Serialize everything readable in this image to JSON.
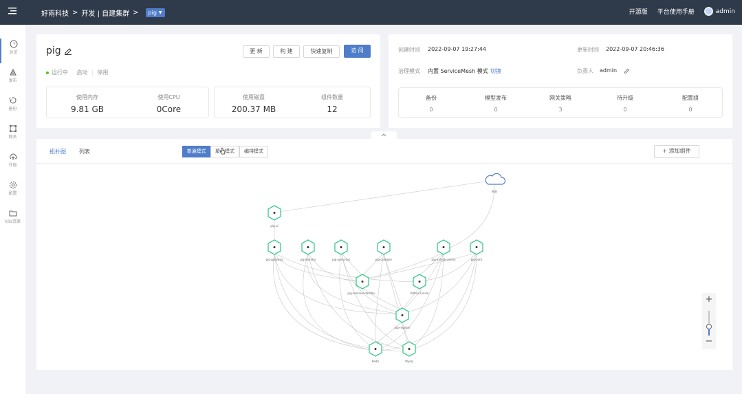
{
  "topbar": {
    "org": "好雨科技",
    "sep1": ">",
    "team": "开发 | 自建集群",
    "sep2": ">",
    "app": "pig",
    "open_source": "开源版",
    "manual": "平台使用手册",
    "user": "admin"
  },
  "sidebar": {
    "items": [
      {
        "label": "总览",
        "icon": "dashboard-icon"
      },
      {
        "label": "发布",
        "icon": "publish-icon"
      },
      {
        "label": "备份",
        "icon": "backup-icon"
      },
      {
        "label": "网关",
        "icon": "gateway-icon"
      },
      {
        "label": "升级",
        "icon": "upgrade-icon"
      },
      {
        "label": "配置",
        "icon": "config-icon"
      },
      {
        "label": "k8s资源",
        "icon": "folder-icon"
      }
    ]
  },
  "app_card": {
    "name": "pig",
    "status": "运行中",
    "start": "启动",
    "divider": "|",
    "stop": "停用",
    "buttons": {
      "update": "更 新",
      "build": "构 建",
      "copy": "快速复制",
      "visit": "访 问"
    },
    "stats": [
      {
        "label": "使用内存",
        "value": "9.81 GB"
      },
      {
        "label": "使用CPU",
        "value": "0Core"
      },
      {
        "label": "使用磁盘",
        "value": "200.37 MB"
      },
      {
        "label": "组件数量",
        "value": "12"
      }
    ]
  },
  "info_card": {
    "created_label": "创建时间",
    "created": "2022-09-07 19:27:44",
    "updated_label": "更新时间",
    "updated": "2022-09-07 20:46:36",
    "gov_label": "治理模式",
    "gov_value": "内置 ServiceMesh 模式",
    "gov_switch": "切换",
    "owner_label": "负责人",
    "owner": "admin",
    "counts": [
      {
        "label": "备份",
        "value": "0"
      },
      {
        "label": "模型发布",
        "value": "0"
      },
      {
        "label": "网关策略",
        "value": "3"
      },
      {
        "label": "待升级",
        "value": "0"
      },
      {
        "label": "配置组",
        "value": "0"
      }
    ]
  },
  "topology": {
    "tabs": {
      "topology": "拓扑图",
      "list": "列表"
    },
    "modes": [
      "普通模式",
      "聚合模式",
      "编排模式"
    ],
    "add_component": "+ 添加组件",
    "zoom_in": "+",
    "zoom_out": "−",
    "zoom_level": 0.35,
    "nodes": [
      {
        "id": "internet",
        "label": "网关"
      },
      {
        "id": "pigui",
        "label": "pig-ui"
      },
      {
        "id": "gateway",
        "label": "pig-gateway"
      },
      {
        "id": "monitor",
        "label": "pig-monitor"
      },
      {
        "id": "upms",
        "label": "pig-upms-biz"
      },
      {
        "id": "codegen",
        "label": "pig-codegen"
      },
      {
        "id": "xxljob",
        "label": "pig-xxl-job-admin"
      },
      {
        "id": "auth",
        "label": "pig-auth"
      },
      {
        "id": "sentinel",
        "label": "pig-sentinel-dashbo..."
      },
      {
        "id": "arthas",
        "label": "Arthas-Tunnel"
      },
      {
        "id": "register",
        "label": "pig-register"
      },
      {
        "id": "redis",
        "label": "Redis"
      },
      {
        "id": "mysql",
        "label": "Mysql"
      }
    ]
  }
}
